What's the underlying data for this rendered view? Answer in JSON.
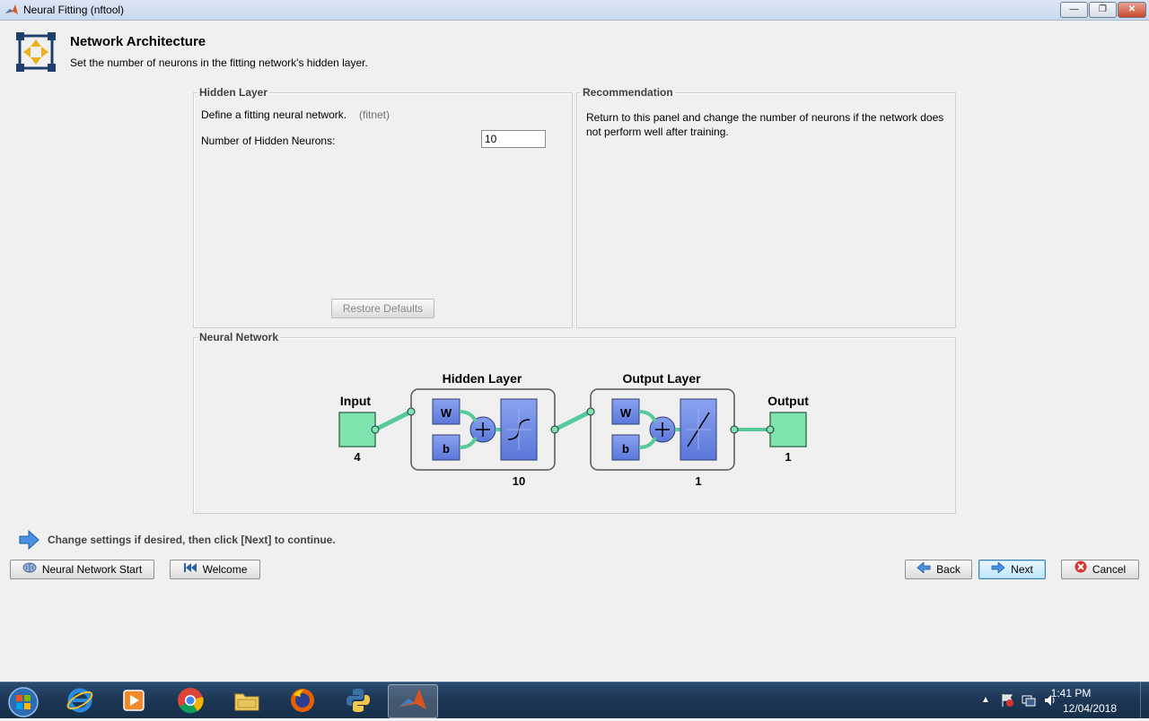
{
  "window": {
    "title": "Neural Fitting (nftool)",
    "minimize": "—",
    "restore": "❐",
    "close": "✕"
  },
  "header": {
    "title": "Network Architecture",
    "subtitle": "Set the number of neurons in the fitting network's hidden layer."
  },
  "hidden_layer_panel": {
    "legend": "Hidden Layer",
    "define_text": "Define a fitting neural network.",
    "define_hint": "(fitnet)",
    "neurons_label": "Number of Hidden Neurons:",
    "neurons_value": "10",
    "restore_button": "Restore Defaults"
  },
  "recommendation_panel": {
    "legend": "Recommendation",
    "text": "Return to this panel and change the number of neurons if the network does not perform well after training."
  },
  "network_panel": {
    "legend": "Neural Network",
    "input_label": "Input",
    "input_size": "4",
    "hidden_title": "Hidden Layer",
    "hidden_size": "10",
    "output_title": "Output Layer",
    "output_size": "1",
    "output_label": "Output",
    "output_value": "1",
    "w_label": "W",
    "b_label": "b"
  },
  "instruction": "Change settings  if desired, then click [Next] to continue.",
  "buttons": {
    "nn_start": "Neural Network Start",
    "welcome": "Welcome",
    "back": "Back",
    "next": "Next",
    "cancel": "Cancel"
  },
  "taskbar": {
    "apps": [
      "start-orb",
      "internet-explorer",
      "media-player",
      "chrome",
      "file-explorer",
      "firefox",
      "python",
      "matlab"
    ],
    "time": "1:41 PM",
    "date": "12/04/2018"
  }
}
